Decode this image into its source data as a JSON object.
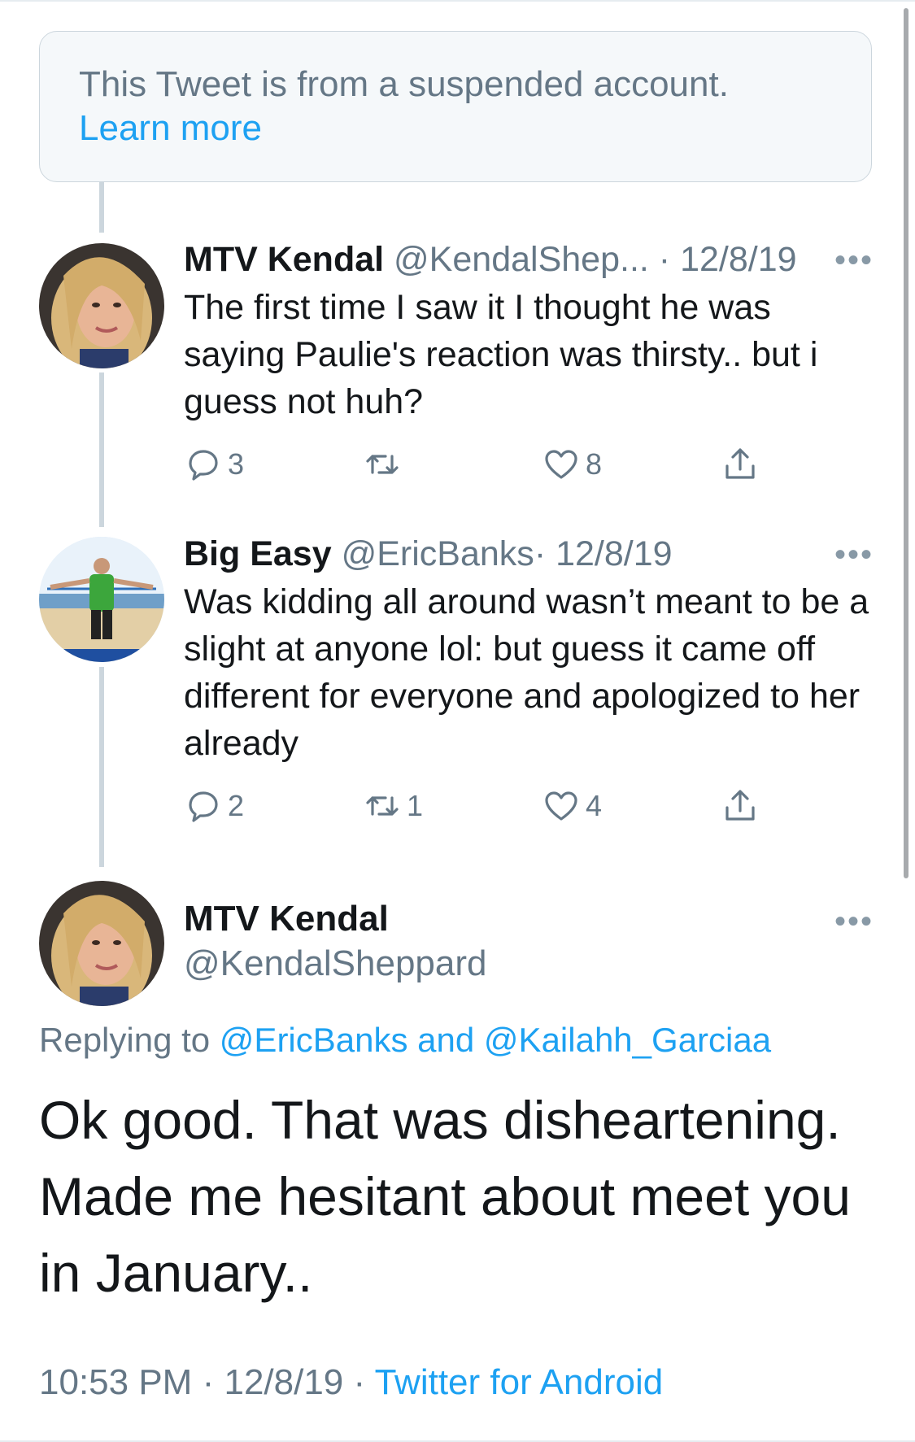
{
  "suspended_notice": {
    "text": "This Tweet is from a suspended account.",
    "link": "Learn more"
  },
  "replies": [
    {
      "name": "MTV Kendal",
      "handle": "@KendalShep...",
      "date": "12/8/19",
      "text": "The first time I saw it I thought he was saying Paulie's reaction was thirsty.. but i guess not huh?",
      "reply_count": "3",
      "retweet_count": "",
      "like_count": "8",
      "avatar": "woman-blonde-avatar"
    },
    {
      "name": "Big Easy",
      "handle": "@EricBanks",
      "date": "12/8/19",
      "text": "Was kidding all around wasn’t meant to be a slight at anyone lol: but guess  it came off different for everyone and apologized to her already",
      "reply_count": "2",
      "retweet_count": "1",
      "like_count": "4",
      "avatar": "man-beach-avatar"
    }
  ],
  "main_tweet": {
    "name": "MTV Kendal",
    "handle": "@KendalSheppard",
    "replying_prefix": "Replying to",
    "replying_user1": "@EricBanks",
    "replying_and": "and",
    "replying_user2": "@Kailahh_Garciaa",
    "text": "Ok good. That was disheartening. Made me hesitant about meet you in January..",
    "time": "10:53 PM",
    "date": "12/8/19",
    "source": "Twitter for Android"
  },
  "ui": {
    "separator": "·",
    "more": "•••"
  },
  "colors": {
    "accent": "#1da1f2",
    "muted": "#657786",
    "text": "#14171a",
    "border": "#ccd6dd"
  }
}
